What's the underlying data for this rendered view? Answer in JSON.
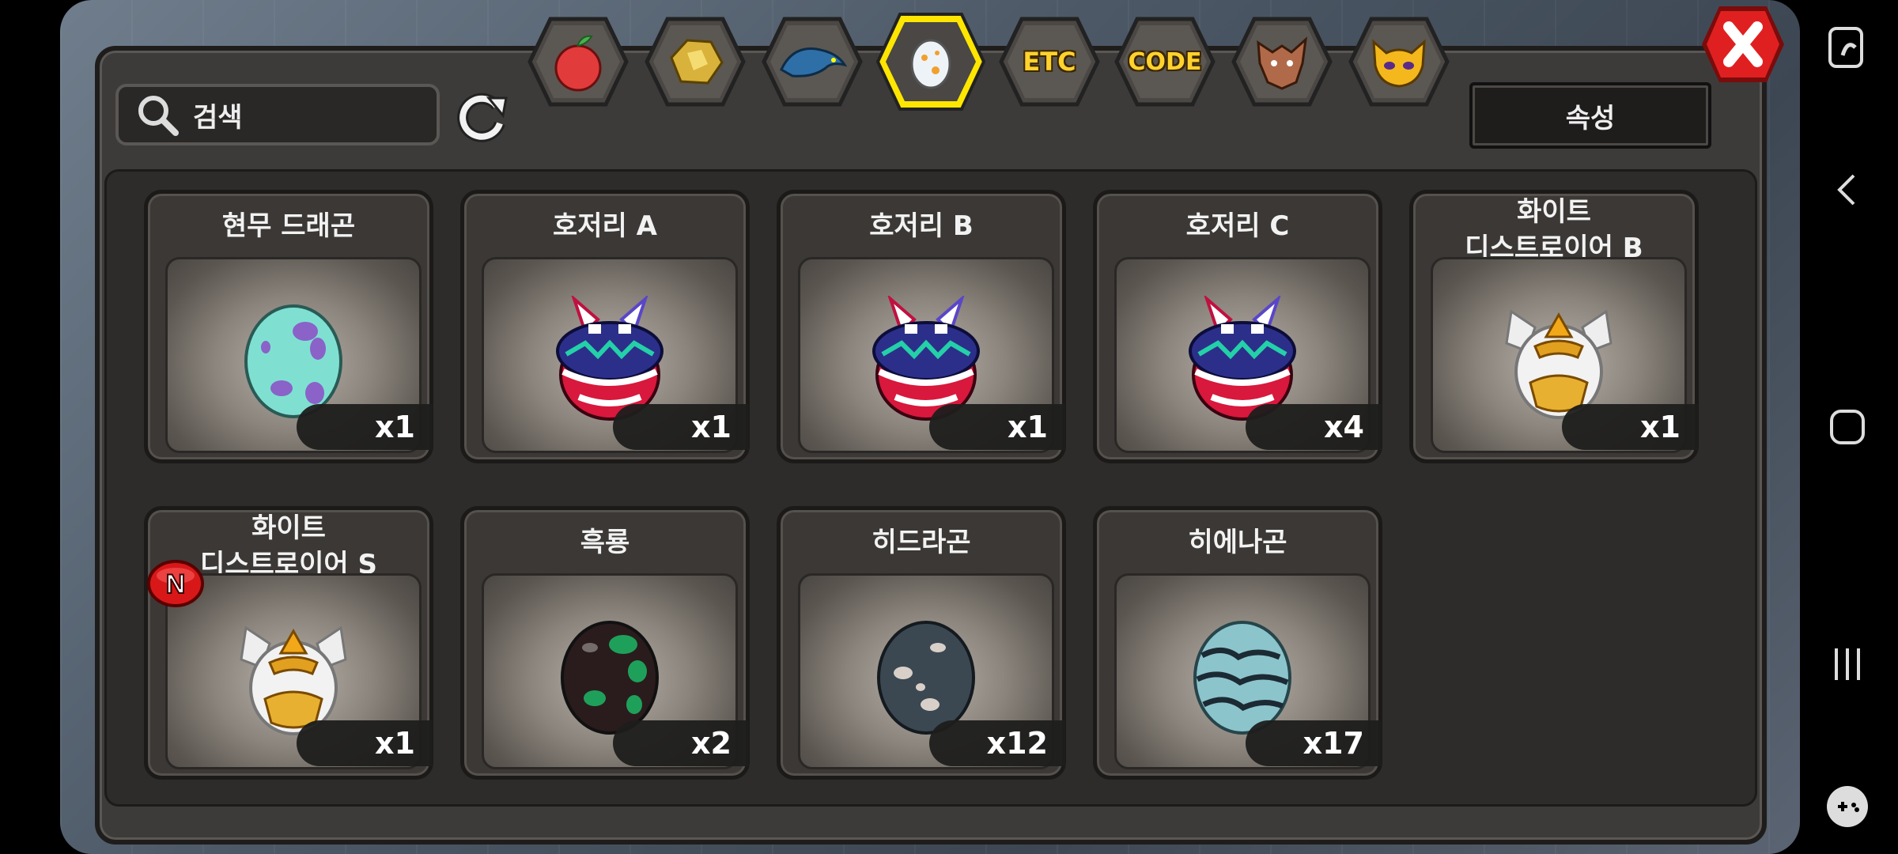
{
  "search": {
    "placeholder": "검색"
  },
  "attribute_button": "속성",
  "tabs": [
    {
      "name": "fruit-tab-icon",
      "label": ""
    },
    {
      "name": "ore-tab-icon",
      "label": ""
    },
    {
      "name": "dragon-tab-icon",
      "label": ""
    },
    {
      "name": "egg-tab-icon",
      "label": "",
      "active": true
    },
    {
      "name": "etc-tab",
      "label": "ETC"
    },
    {
      "name": "code-tab",
      "label": "CODE"
    },
    {
      "name": "beast-tab-icon",
      "label": ""
    },
    {
      "name": "mask-tab-icon",
      "label": ""
    }
  ],
  "items": [
    {
      "name": "현무 드래곤",
      "qty": "x1",
      "icon": "teal-purple-egg"
    },
    {
      "name": "호저리 A",
      "qty": "x1",
      "icon": "hojeori-egg"
    },
    {
      "name": "호저리 B",
      "qty": "x1",
      "icon": "hojeori-egg"
    },
    {
      "name": "호저리 C",
      "qty": "x4",
      "icon": "hojeori-egg"
    },
    {
      "name_line1": "화이트",
      "name_line2": "디스트로이어 B",
      "qty": "x1",
      "icon": "white-destroyer-egg"
    },
    {
      "name_line1": "화이트",
      "name_line2": "디스트로이어 S",
      "qty": "x1",
      "icon": "white-destroyer-egg",
      "new_badge": "N"
    },
    {
      "name": "흑룡",
      "qty": "x2",
      "icon": "black-green-egg"
    },
    {
      "name": "히드라곤",
      "qty": "x12",
      "icon": "slate-spotted-egg"
    },
    {
      "name": "히에나곤",
      "qty": "x17",
      "icon": "striped-blue-egg"
    }
  ],
  "colors": {
    "panel": "#3d3b39",
    "highlight": "#ffe600",
    "qty_bg": "#1e1d1c"
  }
}
